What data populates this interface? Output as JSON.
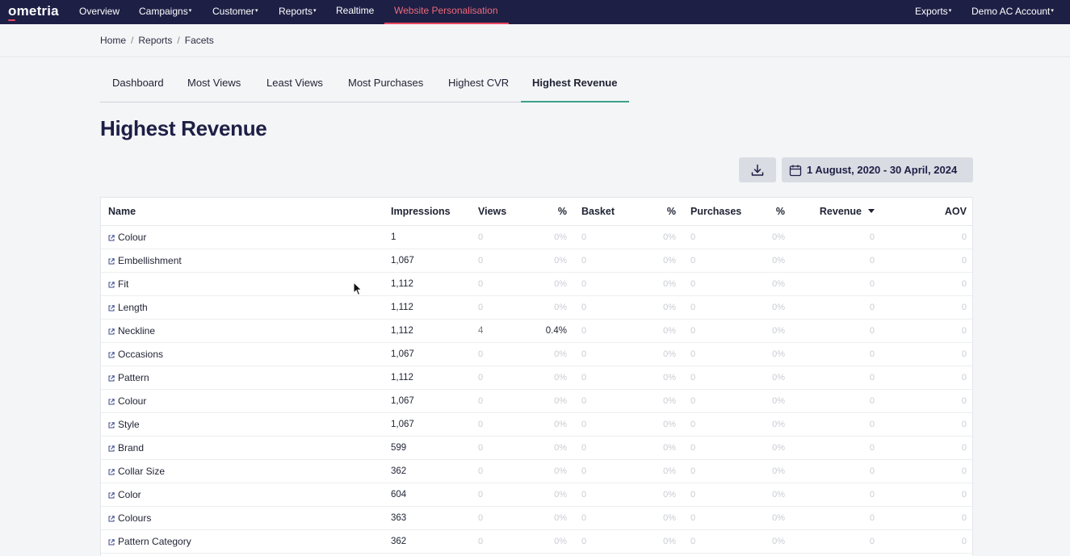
{
  "app": {
    "logo": "ometria"
  },
  "nav": {
    "items": [
      {
        "label": "Overview",
        "caret": ""
      },
      {
        "label": "Campaigns",
        "caret": "▾"
      },
      {
        "label": "Customer",
        "caret": "▾"
      },
      {
        "label": "Reports",
        "caret": "▾"
      },
      {
        "label": "Realtime",
        "caret": ""
      },
      {
        "label": "Website Personalisation",
        "caret": ""
      }
    ],
    "right": [
      {
        "label": "Exports",
        "caret": "▾"
      },
      {
        "label": "Demo AC Account",
        "caret": "▾"
      }
    ]
  },
  "breadcrumb": [
    "Home",
    "Reports",
    "Facets"
  ],
  "breadcrumb_sep": "/",
  "tabs": [
    "Dashboard",
    "Most Views",
    "Least Views",
    "Most Purchases",
    "Highest CVR",
    "Highest Revenue"
  ],
  "page_title": "Highest Revenue",
  "date_range": "1 August, 2020 - 30 April, 2024",
  "table": {
    "headers": [
      "Name",
      "Impressions",
      "Views",
      "%",
      "Basket",
      "%",
      "Purchases",
      "%",
      "Revenue",
      "AOV"
    ],
    "rows": [
      [
        "Colour",
        "1",
        "0",
        "0%",
        "0",
        "0%",
        "0",
        "0%",
        "0",
        "0"
      ],
      [
        "Embellishment",
        "1,067",
        "0",
        "0%",
        "0",
        "0%",
        "0",
        "0%",
        "0",
        "0"
      ],
      [
        "Fit",
        "1,112",
        "0",
        "0%",
        "0",
        "0%",
        "0",
        "0%",
        "0",
        "0"
      ],
      [
        "Length",
        "1,112",
        "0",
        "0%",
        "0",
        "0%",
        "0",
        "0%",
        "0",
        "0"
      ],
      [
        "Neckline",
        "1,112",
        "4",
        "0.4%",
        "0",
        "0%",
        "0",
        "0%",
        "0",
        "0"
      ],
      [
        "Occasions",
        "1,067",
        "0",
        "0%",
        "0",
        "0%",
        "0",
        "0%",
        "0",
        "0"
      ],
      [
        "Pattern",
        "1,112",
        "0",
        "0%",
        "0",
        "0%",
        "0",
        "0%",
        "0",
        "0"
      ],
      [
        "Colour",
        "1,067",
        "0",
        "0%",
        "0",
        "0%",
        "0",
        "0%",
        "0",
        "0"
      ],
      [
        "Style",
        "1,067",
        "0",
        "0%",
        "0",
        "0%",
        "0",
        "0%",
        "0",
        "0"
      ],
      [
        "Brand",
        "599",
        "0",
        "0%",
        "0",
        "0%",
        "0",
        "0%",
        "0",
        "0"
      ],
      [
        "Collar Size",
        "362",
        "0",
        "0%",
        "0",
        "0%",
        "0",
        "0%",
        "0",
        "0"
      ],
      [
        "Color",
        "604",
        "0",
        "0%",
        "0",
        "0%",
        "0",
        "0%",
        "0",
        "0"
      ],
      [
        "Colours",
        "363",
        "0",
        "0%",
        "0",
        "0%",
        "0",
        "0%",
        "0",
        "0"
      ],
      [
        "Pattern Category",
        "362",
        "0",
        "0%",
        "0",
        "0%",
        "0",
        "0%",
        "0",
        "0"
      ],
      [
        "",
        "",
        "",
        "",
        "",
        "",
        "",
        "",
        "",
        ""
      ]
    ]
  },
  "icons": {
    "download": "download-icon",
    "calendar": "calendar-icon",
    "external": "external-link-icon",
    "sort": "sort-desc-icon",
    "cursor": "mouse-cursor-icon"
  },
  "colors": {
    "nav_bg": "#1d1f45",
    "accent_red": "#e8475f",
    "tab_active": "#3aa28a"
  }
}
